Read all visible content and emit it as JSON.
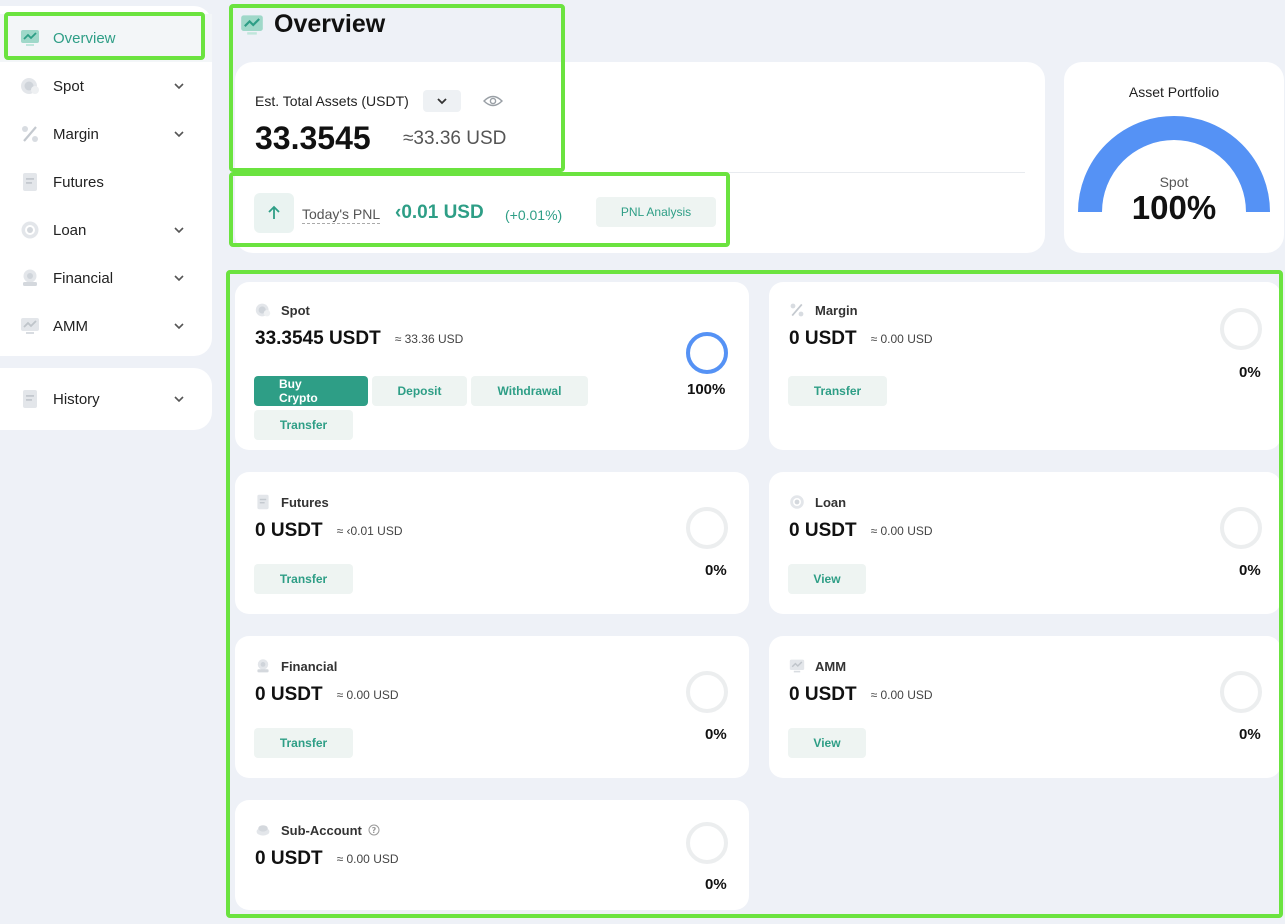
{
  "sidebar": {
    "items": [
      {
        "label": "Overview",
        "icon": "overview-chart-icon"
      },
      {
        "label": "Spot",
        "icon": "spot-coin-icon"
      },
      {
        "label": "Margin",
        "icon": "margin-percent-icon"
      },
      {
        "label": "Futures",
        "icon": "futures-doc-icon"
      },
      {
        "label": "Loan",
        "icon": "loan-icon"
      },
      {
        "label": "Financial",
        "icon": "financial-icon"
      },
      {
        "label": "AMM",
        "icon": "amm-icon"
      }
    ],
    "history": {
      "label": "History",
      "icon": "history-doc-icon"
    }
  },
  "page": {
    "title": "Overview"
  },
  "summary": {
    "est_label": "Est. Total Assets (USDT)",
    "total_value": "33.3545",
    "total_usd": "≈33.36 USD",
    "pnl_label": "Today's PNL",
    "pnl_value": "‹0.01 USD",
    "pnl_pct": "(+0.01%)",
    "pnl_button": "PNL Analysis"
  },
  "portfolio": {
    "title": "Asset Portfolio",
    "label": "Spot",
    "pct": "100%",
    "fraction": 1.0,
    "color": "#5592f5"
  },
  "accounts": {
    "spot": {
      "name": "Spot",
      "value": "33.3545 USDT",
      "usd": "≈ 33.36 USD",
      "pct": "100%",
      "fraction": 1.0,
      "buttons": [
        "Buy Crypto",
        "Deposit",
        "Withdrawal",
        "Transfer"
      ]
    },
    "margin": {
      "name": "Margin",
      "value": "0 USDT",
      "usd": "≈ 0.00 USD",
      "pct": "0%",
      "fraction": 0,
      "buttons": [
        "Transfer"
      ]
    },
    "futures": {
      "name": "Futures",
      "value": "0 USDT",
      "usd": "≈ ‹0.01 USD",
      "pct": "0%",
      "fraction": 0,
      "buttons": [
        "Transfer"
      ]
    },
    "loan": {
      "name": "Loan",
      "value": "0 USDT",
      "usd": "≈ 0.00 USD",
      "pct": "0%",
      "fraction": 0,
      "buttons": [
        "View"
      ]
    },
    "financial": {
      "name": "Financial",
      "value": "0 USDT",
      "usd": "≈ 0.00 USD",
      "pct": "0%",
      "fraction": 0,
      "buttons": [
        "Transfer"
      ]
    },
    "amm": {
      "name": "AMM",
      "value": "0 USDT",
      "usd": "≈ 0.00 USD",
      "pct": "0%",
      "fraction": 0,
      "buttons": [
        "View"
      ]
    },
    "subaccount": {
      "name": "Sub-Account",
      "value": "0 USDT",
      "usd": "≈ 0.00 USD",
      "pct": "0%",
      "fraction": 0
    }
  },
  "colors": {
    "accent": "#2e9e86",
    "ring_active": "#5592f5",
    "ring_empty": "#eceeef",
    "highlight": "#6be33f"
  }
}
